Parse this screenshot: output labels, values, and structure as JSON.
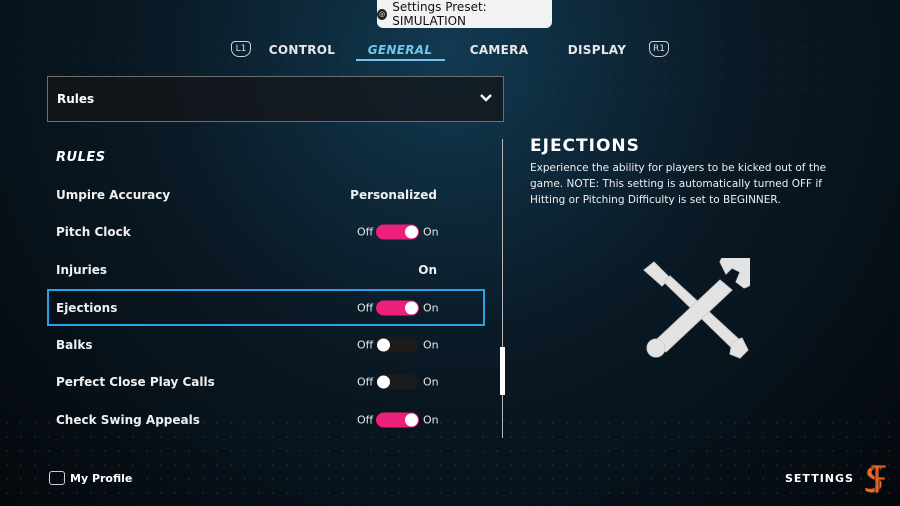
{
  "preset": {
    "label": "Settings Preset: SIMULATION",
    "icon": "preset-badge-icon"
  },
  "tabs": {
    "left_bumper": "L1",
    "right_bumper": "R1",
    "items": [
      {
        "label": "CONTROL",
        "active": false
      },
      {
        "label": "GENERAL",
        "active": true
      },
      {
        "label": "CAMERA",
        "active": false
      },
      {
        "label": "DISPLAY",
        "active": false
      }
    ]
  },
  "dropdown": {
    "selected": "Rules",
    "icon": "chevron-down-icon"
  },
  "section": {
    "heading": "RULES"
  },
  "rows": [
    {
      "label": "Umpire Accuracy",
      "type": "value",
      "value": "Personalized"
    },
    {
      "label": "Pitch Clock",
      "type": "toggle",
      "off_label": "Off",
      "on_label": "On",
      "state": "on"
    },
    {
      "label": "Injuries",
      "type": "value",
      "value": "On"
    },
    {
      "label": "Ejections",
      "type": "toggle",
      "off_label": "Off",
      "on_label": "On",
      "state": "on",
      "selected": true
    },
    {
      "label": "Balks",
      "type": "toggle",
      "off_label": "Off",
      "on_label": "On",
      "state": "off"
    },
    {
      "label": "Perfect Close Play Calls",
      "type": "toggle",
      "off_label": "Off",
      "on_label": "On",
      "state": "off"
    },
    {
      "label": "Check Swing Appeals",
      "type": "toggle",
      "off_label": "Off",
      "on_label": "On",
      "state": "on"
    }
  ],
  "detail": {
    "title": "EJECTIONS",
    "description": "Experience the ability for players to be kicked out of the game. NOTE: This setting is automatically turned OFF if Hitting or Pitching Difficulty is set to BEGINNER.",
    "icon": "wrench-screwdriver-icon"
  },
  "footer": {
    "profile_label": "My Profile",
    "screen_title": "SETTINGS",
    "logo": "sf-giants-logo"
  },
  "colors": {
    "accent_blue": "#2aa3e6",
    "tab_active": "#6fc7ee",
    "toggle_on": "#ec1f7a",
    "logo_orange": "#f26522"
  }
}
